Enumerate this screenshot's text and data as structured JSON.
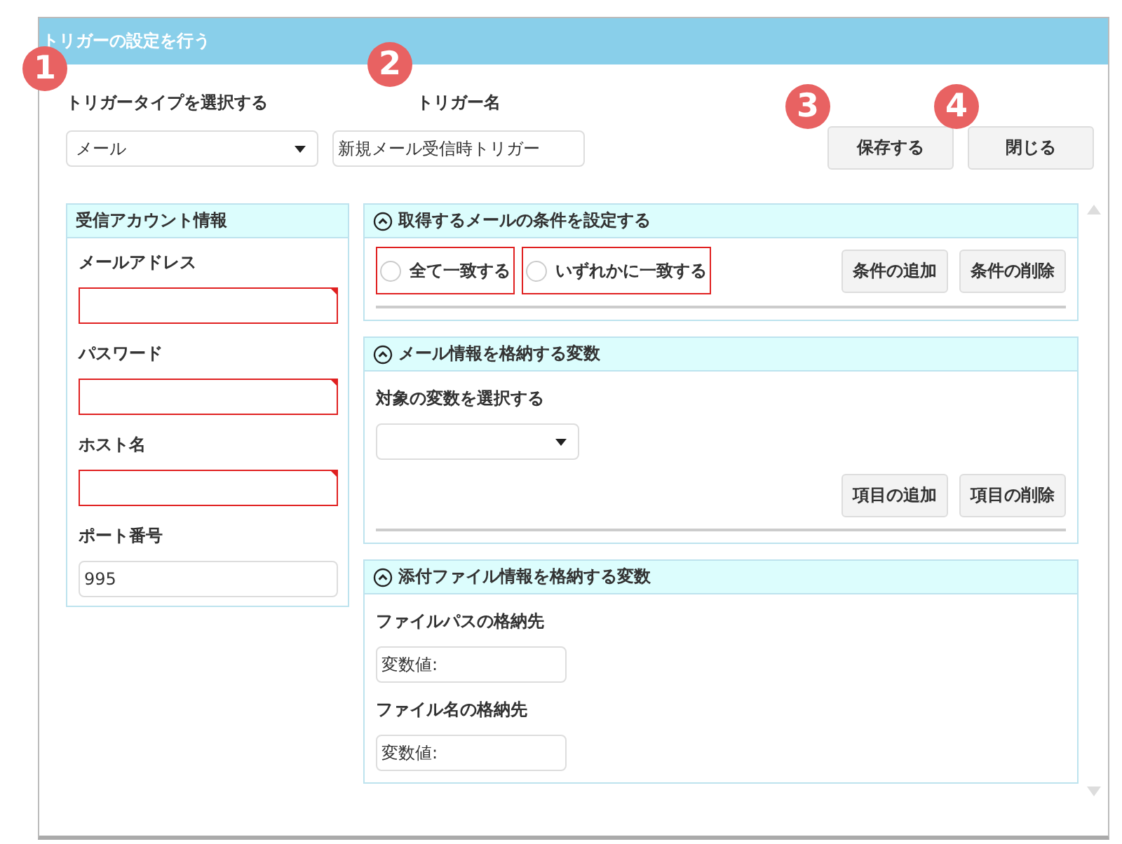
{
  "window": {
    "title": "トリガーの設定を行う"
  },
  "trigger_type": {
    "marker": "1",
    "label": "トリガータイプを選択する",
    "value": "メール"
  },
  "trigger_name": {
    "marker": "2",
    "label": "トリガー名",
    "value": "新規メール受信時トリガー"
  },
  "buttons": [
    {
      "label": "保存する",
      "marker": "3"
    },
    {
      "label": "閉じる",
      "marker": "4"
    }
  ],
  "account": {
    "title": "受信アカウント情報",
    "fields": [
      {
        "label": "メールアドレス",
        "invalid": true
      },
      {
        "label": "パスワード",
        "invalid": true
      },
      {
        "label": "ホスト名",
        "invalid": true
      },
      {
        "label": "ポート番号",
        "value": "995",
        "invalid": false
      }
    ]
  },
  "sections": [
    {
      "kind": "conditions",
      "title": "取得するメールの条件を設定する",
      "expanded": true,
      "options": [
        {
          "label": "全て一致する",
          "selected": false,
          "invalid": true
        },
        {
          "label": "いずれかに一致する",
          "selected": false,
          "invalid": true
        }
      ],
      "buttons": [
        "条件の追加",
        "条件の削除"
      ]
    },
    {
      "kind": "variables",
      "title": "メール情報を格納する変数",
      "expanded": true,
      "label": "対象の変数を選択する",
      "buttons": [
        "項目の追加",
        "項目の削除"
      ]
    },
    {
      "kind": "attachments",
      "title": "添付ファイル情報を格納する変数",
      "expanded": true,
      "fields": [
        {
          "label": "ファイルパスの格納先",
          "value": "変数値:"
        },
        {
          "label": "ファイル名の格納先",
          "value": "変数値:"
        }
      ]
    }
  ]
}
